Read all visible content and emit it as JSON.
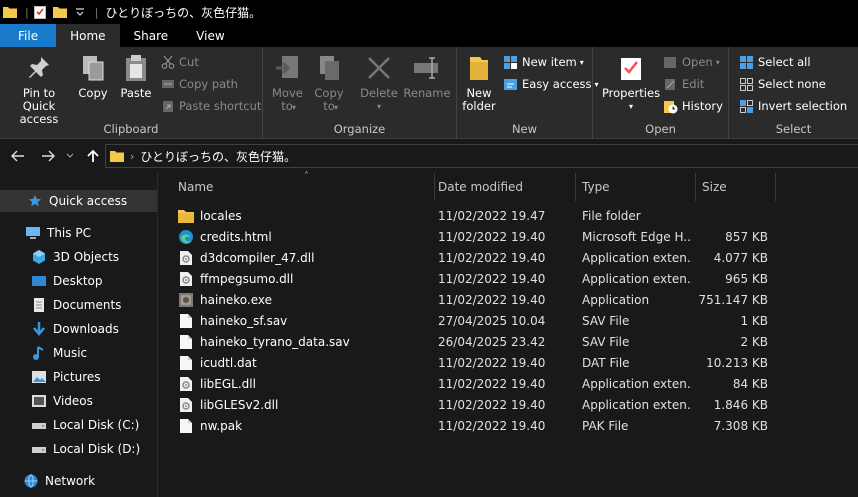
{
  "window": {
    "title": "ひとりぼっちの、灰色仔猫。",
    "colors": {
      "file_tab": "#1979ca",
      "ribbon_bg": "#2b2b2b",
      "content_bg": "#191919",
      "folder": "#f2c94c"
    }
  },
  "tabs": [
    {
      "label": "File"
    },
    {
      "label": "Home"
    },
    {
      "label": "Share"
    },
    {
      "label": "View"
    }
  ],
  "ribbon": {
    "clipboard": {
      "label": "Clipboard",
      "pin": "Pin to Quick access",
      "copy": "Copy",
      "paste": "Paste",
      "cut": "Cut",
      "copy_path": "Copy path",
      "paste_shortcut": "Paste shortcut"
    },
    "organize": {
      "label": "Organize",
      "move_to": "Move to",
      "copy_to": "Copy to",
      "delete": "Delete",
      "rename": "Rename"
    },
    "new": {
      "label": "New",
      "new_folder": "New folder",
      "new_item": "New item",
      "easy_access": "Easy access"
    },
    "open": {
      "label": "Open",
      "properties": "Properties",
      "open": "Open",
      "edit": "Edit",
      "history": "History"
    },
    "select": {
      "label": "Select",
      "select_all": "Select all",
      "select_none": "Select none",
      "invert_selection": "Invert selection"
    }
  },
  "address": {
    "path": "ひとりぼっちの、灰色仔猫。"
  },
  "nav": [
    {
      "label": "Quick access",
      "icon": "star-icon"
    },
    {
      "label": "This PC",
      "icon": "pc-icon"
    },
    {
      "label": "3D Objects",
      "icon": "cube-icon"
    },
    {
      "label": "Desktop",
      "icon": "desktop-icon"
    },
    {
      "label": "Documents",
      "icon": "documents-icon"
    },
    {
      "label": "Downloads",
      "icon": "download-icon"
    },
    {
      "label": "Music",
      "icon": "music-icon"
    },
    {
      "label": "Pictures",
      "icon": "pictures-icon"
    },
    {
      "label": "Videos",
      "icon": "videos-icon"
    },
    {
      "label": "Local Disk (C:)",
      "icon": "drive-icon"
    },
    {
      "label": "Local Disk (D:)",
      "icon": "drive-icon"
    },
    {
      "label": "Network",
      "icon": "network-icon"
    }
  ],
  "columns": {
    "name": "Name",
    "date": "Date modified",
    "type": "Type",
    "size": "Size"
  },
  "files": [
    {
      "name": "locales",
      "date": "11/02/2022 19.47",
      "type": "File folder",
      "size": "",
      "icon": "folder-icon"
    },
    {
      "name": "credits.html",
      "date": "11/02/2022 19.40",
      "type": "Microsoft Edge H...",
      "size": "857 KB",
      "icon": "edge-icon"
    },
    {
      "name": "d3dcompiler_47.dll",
      "date": "11/02/2022 19.40",
      "type": "Application exten...",
      "size": "4.077 KB",
      "icon": "dll-icon"
    },
    {
      "name": "ffmpegsumo.dll",
      "date": "11/02/2022 19.40",
      "type": "Application exten...",
      "size": "965 KB",
      "icon": "dll-icon"
    },
    {
      "name": "haineko.exe",
      "date": "11/02/2022 19.40",
      "type": "Application",
      "size": "751.147 KB",
      "icon": "exe-icon"
    },
    {
      "name": "haineko_sf.sav",
      "date": "27/04/2025 10.04",
      "type": "SAV File",
      "size": "1 KB",
      "icon": "file-icon"
    },
    {
      "name": "haineko_tyrano_data.sav",
      "date": "26/04/2025 23.42",
      "type": "SAV File",
      "size": "2 KB",
      "icon": "file-icon"
    },
    {
      "name": "icudtl.dat",
      "date": "11/02/2022 19.40",
      "type": "DAT File",
      "size": "10.213 KB",
      "icon": "file-icon"
    },
    {
      "name": "libEGL.dll",
      "date": "11/02/2022 19.40",
      "type": "Application exten...",
      "size": "84 KB",
      "icon": "dll-icon"
    },
    {
      "name": "libGLESv2.dll",
      "date": "11/02/2022 19.40",
      "type": "Application exten...",
      "size": "1.846 KB",
      "icon": "dll-icon"
    },
    {
      "name": "nw.pak",
      "date": "11/02/2022 19.40",
      "type": "PAK File",
      "size": "7.308 KB",
      "icon": "file-icon"
    }
  ]
}
